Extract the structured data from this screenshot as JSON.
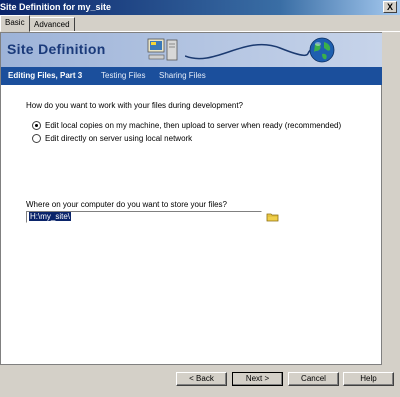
{
  "window": {
    "title": "Site Definition for my_site",
    "close_label": "X"
  },
  "tabs": [
    {
      "label": "Basic"
    },
    {
      "label": "Advanced"
    }
  ],
  "banner": {
    "title": "Site Definition"
  },
  "steps": [
    {
      "label": "Editing Files, Part 3"
    },
    {
      "label": "Testing Files"
    },
    {
      "label": "Sharing Files"
    }
  ],
  "workflow": {
    "question": "How do you want to work with your files during development?",
    "options": [
      {
        "label": "Edit local copies on my machine, then upload to server when ready (recommended)",
        "checked": true
      },
      {
        "label": "Edit directly on server using local network",
        "checked": false
      }
    ]
  },
  "location": {
    "label": "Where on your computer do you want to store your files?",
    "value": "H:\\my_site\\"
  },
  "buttons": {
    "back": "< Back",
    "next": "Next >",
    "cancel": "Cancel",
    "help": "Help"
  },
  "icons": {
    "banner_computer": "computer-icon",
    "banner_globe": "globe-icon",
    "folder": "folder-icon"
  }
}
